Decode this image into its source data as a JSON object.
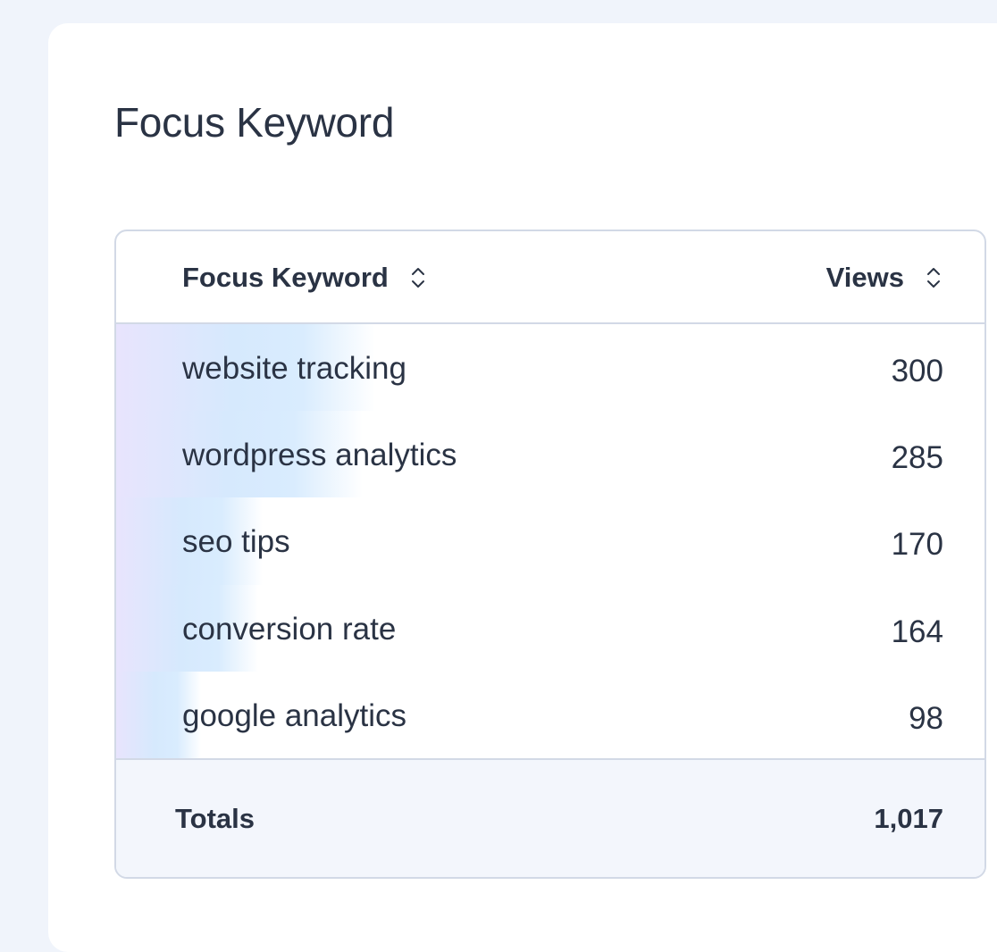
{
  "card": {
    "title": "Focus Keyword"
  },
  "table": {
    "columns": {
      "keyword": "Focus Keyword",
      "views": "Views"
    },
    "max_views": 300,
    "rows": [
      {
        "keyword": "website tracking",
        "views": "300",
        "value": 300
      },
      {
        "keyword": "wordpress analytics",
        "views": "285",
        "value": 285
      },
      {
        "keyword": "seo tips",
        "views": "170",
        "value": 170
      },
      {
        "keyword": "conversion rate",
        "views": "164",
        "value": 164
      },
      {
        "keyword": "google analytics",
        "views": "98",
        "value": 98
      }
    ],
    "totals": {
      "label": "Totals",
      "value": "1,017"
    }
  },
  "colors": {
    "page_background": "#f0f4fb",
    "card_background": "#ffffff",
    "text": "#2a3344",
    "border": "#d2d9e6",
    "bar_start": "#e8e4fd",
    "bar_end": "#d9ecfe",
    "footer_background": "#f3f6fc"
  },
  "icons": {
    "sort": "sort-up-down-icon"
  }
}
